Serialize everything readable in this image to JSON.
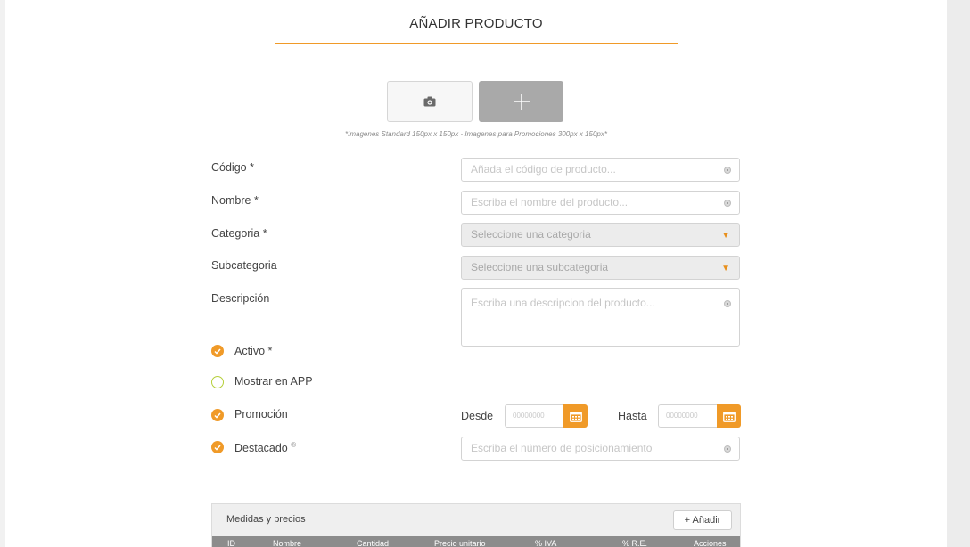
{
  "page": {
    "title": "AÑADIR PRODUCTO"
  },
  "images": {
    "hint": "*Imagenes Standard 150px x 150px - Imagenes para Promociones 300px x 150px*",
    "photo_icon": "camera-icon",
    "add_icon": "plus-icon"
  },
  "form": {
    "codigo": {
      "label": "Código",
      "required": "*",
      "placeholder": "Añada el código de producto..."
    },
    "nombre": {
      "label": "Nombre",
      "required": "*",
      "placeholder": "Escriba el nombre del producto..."
    },
    "categoria": {
      "label": "Categoria",
      "required": "*",
      "placeholder": "Seleccione una categoria"
    },
    "subcategoria": {
      "label": "Subcategoria",
      "placeholder": "Seleccione una subcategoria"
    },
    "descripcion": {
      "label": "Descripción",
      "placeholder": "Escriba una descripcion del producto..."
    }
  },
  "checks": {
    "activo": {
      "label": "Activo",
      "required": "*",
      "checked": true
    },
    "mostrar_app": {
      "label": "Mostrar en APP",
      "checked": false
    },
    "promocion": {
      "label": "Promoción",
      "checked": true
    },
    "destacado": {
      "label": "Destacado",
      "info": "®",
      "checked": true
    }
  },
  "promocion_dates": {
    "desde_label": "Desde",
    "hasta_label": "Hasta",
    "desde_placeholder": "00000000",
    "hasta_placeholder": "00000000"
  },
  "destacado_field": {
    "placeholder": "Escriba el número de posicionamiento"
  },
  "medidas": {
    "title": "Medidas y precios",
    "add_label": "+ Añadir",
    "columns": [
      "ID",
      "Nombre",
      "Cantidad",
      "Precio unitario",
      "% IVA",
      "% R.E.",
      "Acciones"
    ]
  },
  "colors": {
    "accent": "#f09a28",
    "check_off_border": "#b5cf3a",
    "header_bg": "#8c8c8c"
  }
}
